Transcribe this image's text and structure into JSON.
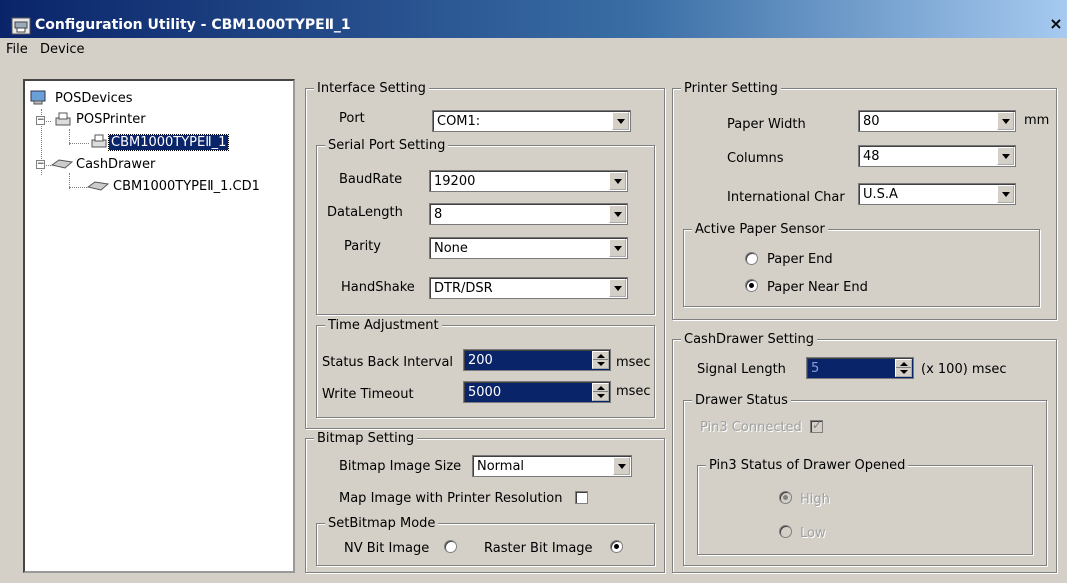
{
  "window": {
    "title": "Configuration Utility -  CBM1000TYPEⅡ_1",
    "close_glyph": "×"
  },
  "menu": {
    "file": "File",
    "device": "Device"
  },
  "tree": {
    "root": "POSDevices",
    "pos_printer": "POSPrinter",
    "printer_device": "CBM1000TYPEⅡ_1",
    "cash_drawer": "CashDrawer",
    "drawer_device": "CBM1000TYPEⅡ_1.CD1",
    "expander_minus": "−"
  },
  "interface": {
    "title": "Interface Setting",
    "port_label": "Port",
    "port_value": "COM1:",
    "serial": {
      "title": "Serial Port Setting",
      "baud_label": "BaudRate",
      "baud_value": "19200",
      "datalength_label": "DataLength",
      "datalength_value": "8",
      "parity_label": "Parity",
      "parity_value": "None",
      "handshake_label": "HandShake",
      "handshake_value": "DTR/DSR"
    },
    "time": {
      "title": "Time Adjustment",
      "status_label": "Status Back Interval",
      "status_value": "200",
      "status_unit": "msec",
      "write_label": "Write Timeout",
      "write_value": "5000",
      "write_unit": "msec"
    }
  },
  "bitmap": {
    "title": "Bitmap Setting",
    "size_label": "Bitmap Image  Size",
    "size_value": "Normal",
    "map_label": "Map Image with Printer Resolution",
    "map_checked": false,
    "mode": {
      "title": "SetBitmap Mode",
      "nv_label": "NV Bit Image",
      "nv_selected": false,
      "raster_label": "Raster Bit Image",
      "raster_selected": true
    }
  },
  "printer": {
    "title": "Printer Setting",
    "width_label": "Paper Width",
    "width_value": "80",
    "width_unit": "mm",
    "columns_label": "Columns",
    "columns_value": "48",
    "intl_label": "International Char",
    "intl_value": "U.S.A",
    "sensor": {
      "title": "Active Paper Sensor",
      "end_label": "Paper End",
      "end_selected": false,
      "near_end_label": "Paper Near End",
      "near_end_selected": true
    }
  },
  "cashdrawer": {
    "title": "CashDrawer Setting",
    "signal_label": "Signal Length",
    "signal_value": "5",
    "signal_unit": "(x 100) msec",
    "status": {
      "title": "Drawer Status",
      "pin3_label": "Pin3 Connected",
      "pin3_checked": true,
      "opened": {
        "title": "Pin3 Status of Drawer Opened",
        "high_label": "High",
        "high_selected": true,
        "low_label": "Low",
        "low_selected": false
      }
    }
  }
}
